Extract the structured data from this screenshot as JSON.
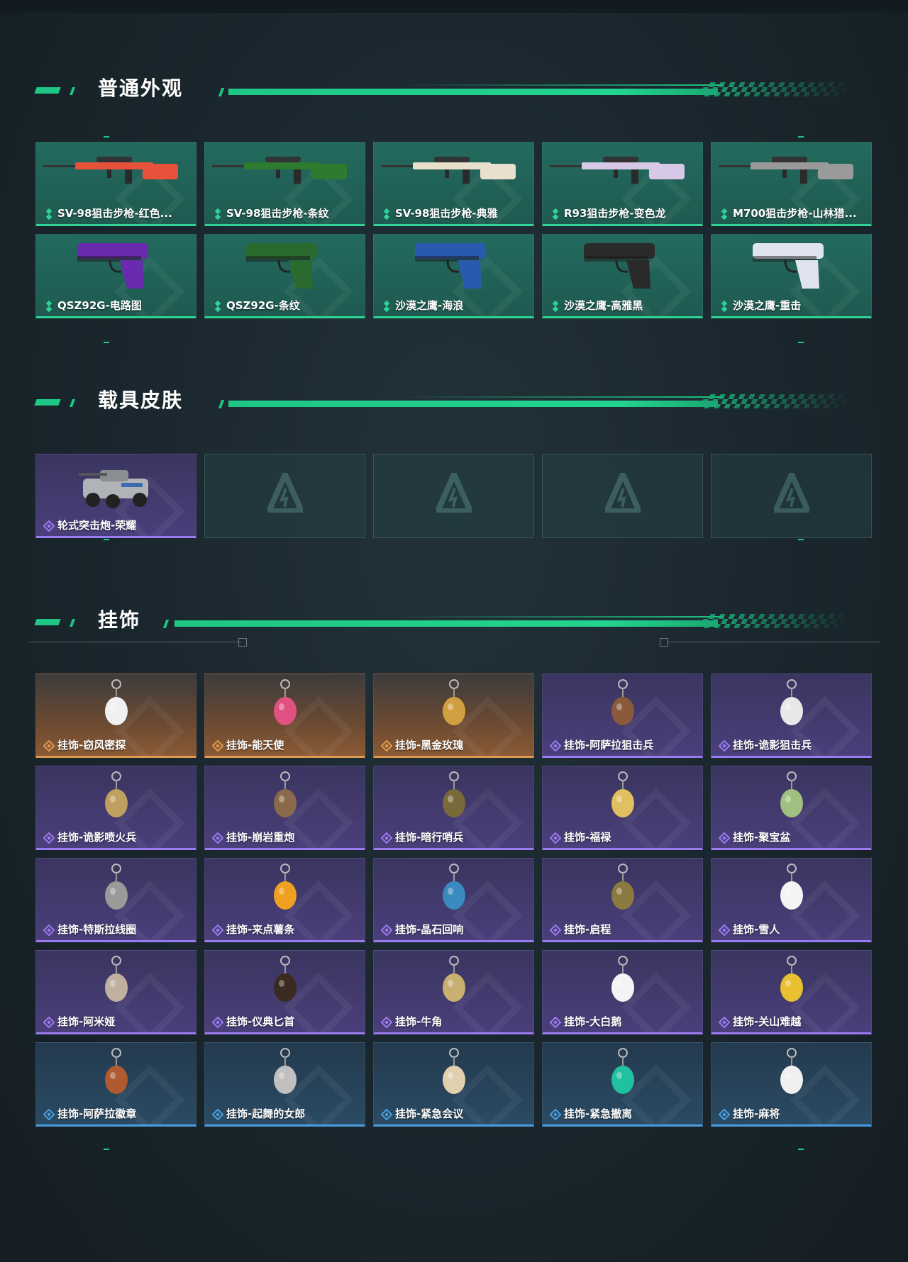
{
  "sections": [
    {
      "title": "普通外观",
      "items": [
        {
          "label": "SV-98狙击步枪-红色...",
          "rarity": "green",
          "icon": "sniper-rifle-icon",
          "color": "#e8523a"
        },
        {
          "label": "SV-98狙击步枪-条纹",
          "rarity": "green",
          "icon": "sniper-rifle-icon",
          "color": "#2e7a2e"
        },
        {
          "label": "SV-98狙击步枪-典雅",
          "rarity": "green",
          "icon": "sniper-rifle-icon",
          "color": "#e8e0cc"
        },
        {
          "label": "R93狙击步枪-变色龙",
          "rarity": "green",
          "icon": "sniper-rifle-icon",
          "color": "#d8c8e8"
        },
        {
          "label": "M700狙击步枪-山林猎...",
          "rarity": "green",
          "icon": "sniper-rifle-icon",
          "color": "#9a9a9a"
        },
        {
          "label": "QSZ92G-电路图",
          "rarity": "green",
          "icon": "pistol-icon",
          "color": "#6a2ab0"
        },
        {
          "label": "QSZ92G-条纹",
          "rarity": "green",
          "icon": "pistol-icon",
          "color": "#2a6a2e"
        },
        {
          "label": "沙漠之鹰-海浪",
          "rarity": "green",
          "icon": "pistol-icon",
          "color": "#2a5ab0"
        },
        {
          "label": "沙漠之鹰-高雅黑",
          "rarity": "green",
          "icon": "pistol-icon",
          "color": "#2a2a2a"
        },
        {
          "label": "沙漠之鹰-重击",
          "rarity": "green",
          "icon": "pistol-icon",
          "color": "#e0e4ee"
        }
      ]
    },
    {
      "title": "载具皮肤",
      "items": [
        {
          "label": "轮式突击炮-荣耀",
          "rarity": "purple",
          "icon": "armored-vehicle-icon",
          "color": "#b0b4b8"
        },
        {
          "label": "",
          "rarity": "empty",
          "icon": "placeholder-logo-icon"
        },
        {
          "label": "",
          "rarity": "empty",
          "icon": "placeholder-logo-icon"
        },
        {
          "label": "",
          "rarity": "empty",
          "icon": "placeholder-logo-icon"
        },
        {
          "label": "",
          "rarity": "empty",
          "icon": "placeholder-logo-icon"
        }
      ]
    },
    {
      "title": "挂饰",
      "items": [
        {
          "label": "挂饰-窃风密探",
          "rarity": "orange",
          "icon": "charm-icon",
          "color": "#f0f0f0"
        },
        {
          "label": "挂饰-能天使",
          "rarity": "orange",
          "icon": "charm-icon",
          "color": "#e05080"
        },
        {
          "label": "挂饰-黑金玫瑰",
          "rarity": "orange",
          "icon": "charm-icon",
          "color": "#d0a040"
        },
        {
          "label": "挂饰-阿萨拉狙击兵",
          "rarity": "purple",
          "icon": "charm-icon",
          "color": "#8a5a3a"
        },
        {
          "label": "挂饰-诡影狙击兵",
          "rarity": "purple",
          "icon": "charm-icon",
          "color": "#e8e8e8"
        },
        {
          "label": "挂饰-诡影喷火兵",
          "rarity": "purple",
          "icon": "charm-icon",
          "color": "#c0a060"
        },
        {
          "label": "挂饰-崩岩重炮",
          "rarity": "purple",
          "icon": "charm-icon",
          "color": "#8a6a4a"
        },
        {
          "label": "挂饰-暗行哨兵",
          "rarity": "purple",
          "icon": "charm-icon",
          "color": "#7a6a3a"
        },
        {
          "label": "挂饰-福禄",
          "rarity": "purple",
          "icon": "charm-icon",
          "color": "#e0c060"
        },
        {
          "label": "挂饰-聚宝盆",
          "rarity": "purple",
          "icon": "charm-icon",
          "color": "#a0c080"
        },
        {
          "label": "挂饰-特斯拉线圈",
          "rarity": "purple",
          "icon": "charm-icon",
          "color": "#9a9a9a"
        },
        {
          "label": "挂饰-来点薯条",
          "rarity": "purple",
          "icon": "charm-icon",
          "color": "#f0a020"
        },
        {
          "label": "挂饰-晶石回响",
          "rarity": "purple",
          "icon": "charm-icon",
          "color": "#3a8ac0"
        },
        {
          "label": "挂饰-启程",
          "rarity": "purple",
          "icon": "charm-icon",
          "color": "#8a7a40"
        },
        {
          "label": "挂饰-雪人",
          "rarity": "purple",
          "icon": "charm-icon",
          "color": "#f4f4f4"
        },
        {
          "label": "挂饰-阿米娅",
          "rarity": "purple",
          "icon": "charm-icon",
          "color": "#c0b0a0"
        },
        {
          "label": "挂饰-仪典匕首",
          "rarity": "purple",
          "icon": "charm-icon",
          "color": "#3a2a20"
        },
        {
          "label": "挂饰-牛角",
          "rarity": "purple",
          "icon": "charm-icon",
          "color": "#c8b070"
        },
        {
          "label": "挂饰-大白鹅",
          "rarity": "purple",
          "icon": "charm-icon",
          "color": "#f4f4f4"
        },
        {
          "label": "挂饰-关山难越",
          "rarity": "purple",
          "icon": "charm-icon",
          "color": "#e8c030"
        },
        {
          "label": "挂饰-阿萨拉徽章",
          "rarity": "blue",
          "icon": "charm-icon",
          "color": "#b05a30"
        },
        {
          "label": "挂饰-起舞的女郎",
          "rarity": "blue",
          "icon": "charm-icon",
          "color": "#c0c0c0"
        },
        {
          "label": "挂饰-紧急会议",
          "rarity": "blue",
          "icon": "charm-icon",
          "color": "#e0d0b0"
        },
        {
          "label": "挂饰-紧急撤离",
          "rarity": "blue",
          "icon": "charm-icon",
          "color": "#20c0a0"
        },
        {
          "label": "挂饰-麻将",
          "rarity": "blue",
          "icon": "charm-icon",
          "color": "#f0f0f0"
        }
      ]
    }
  ],
  "colors": {
    "accent": "#1ec884",
    "green_rarity": "#2fd395",
    "purple_rarity": "#9a7bf0",
    "orange_rarity": "#e09a50",
    "blue_rarity": "#4a9ee0"
  }
}
